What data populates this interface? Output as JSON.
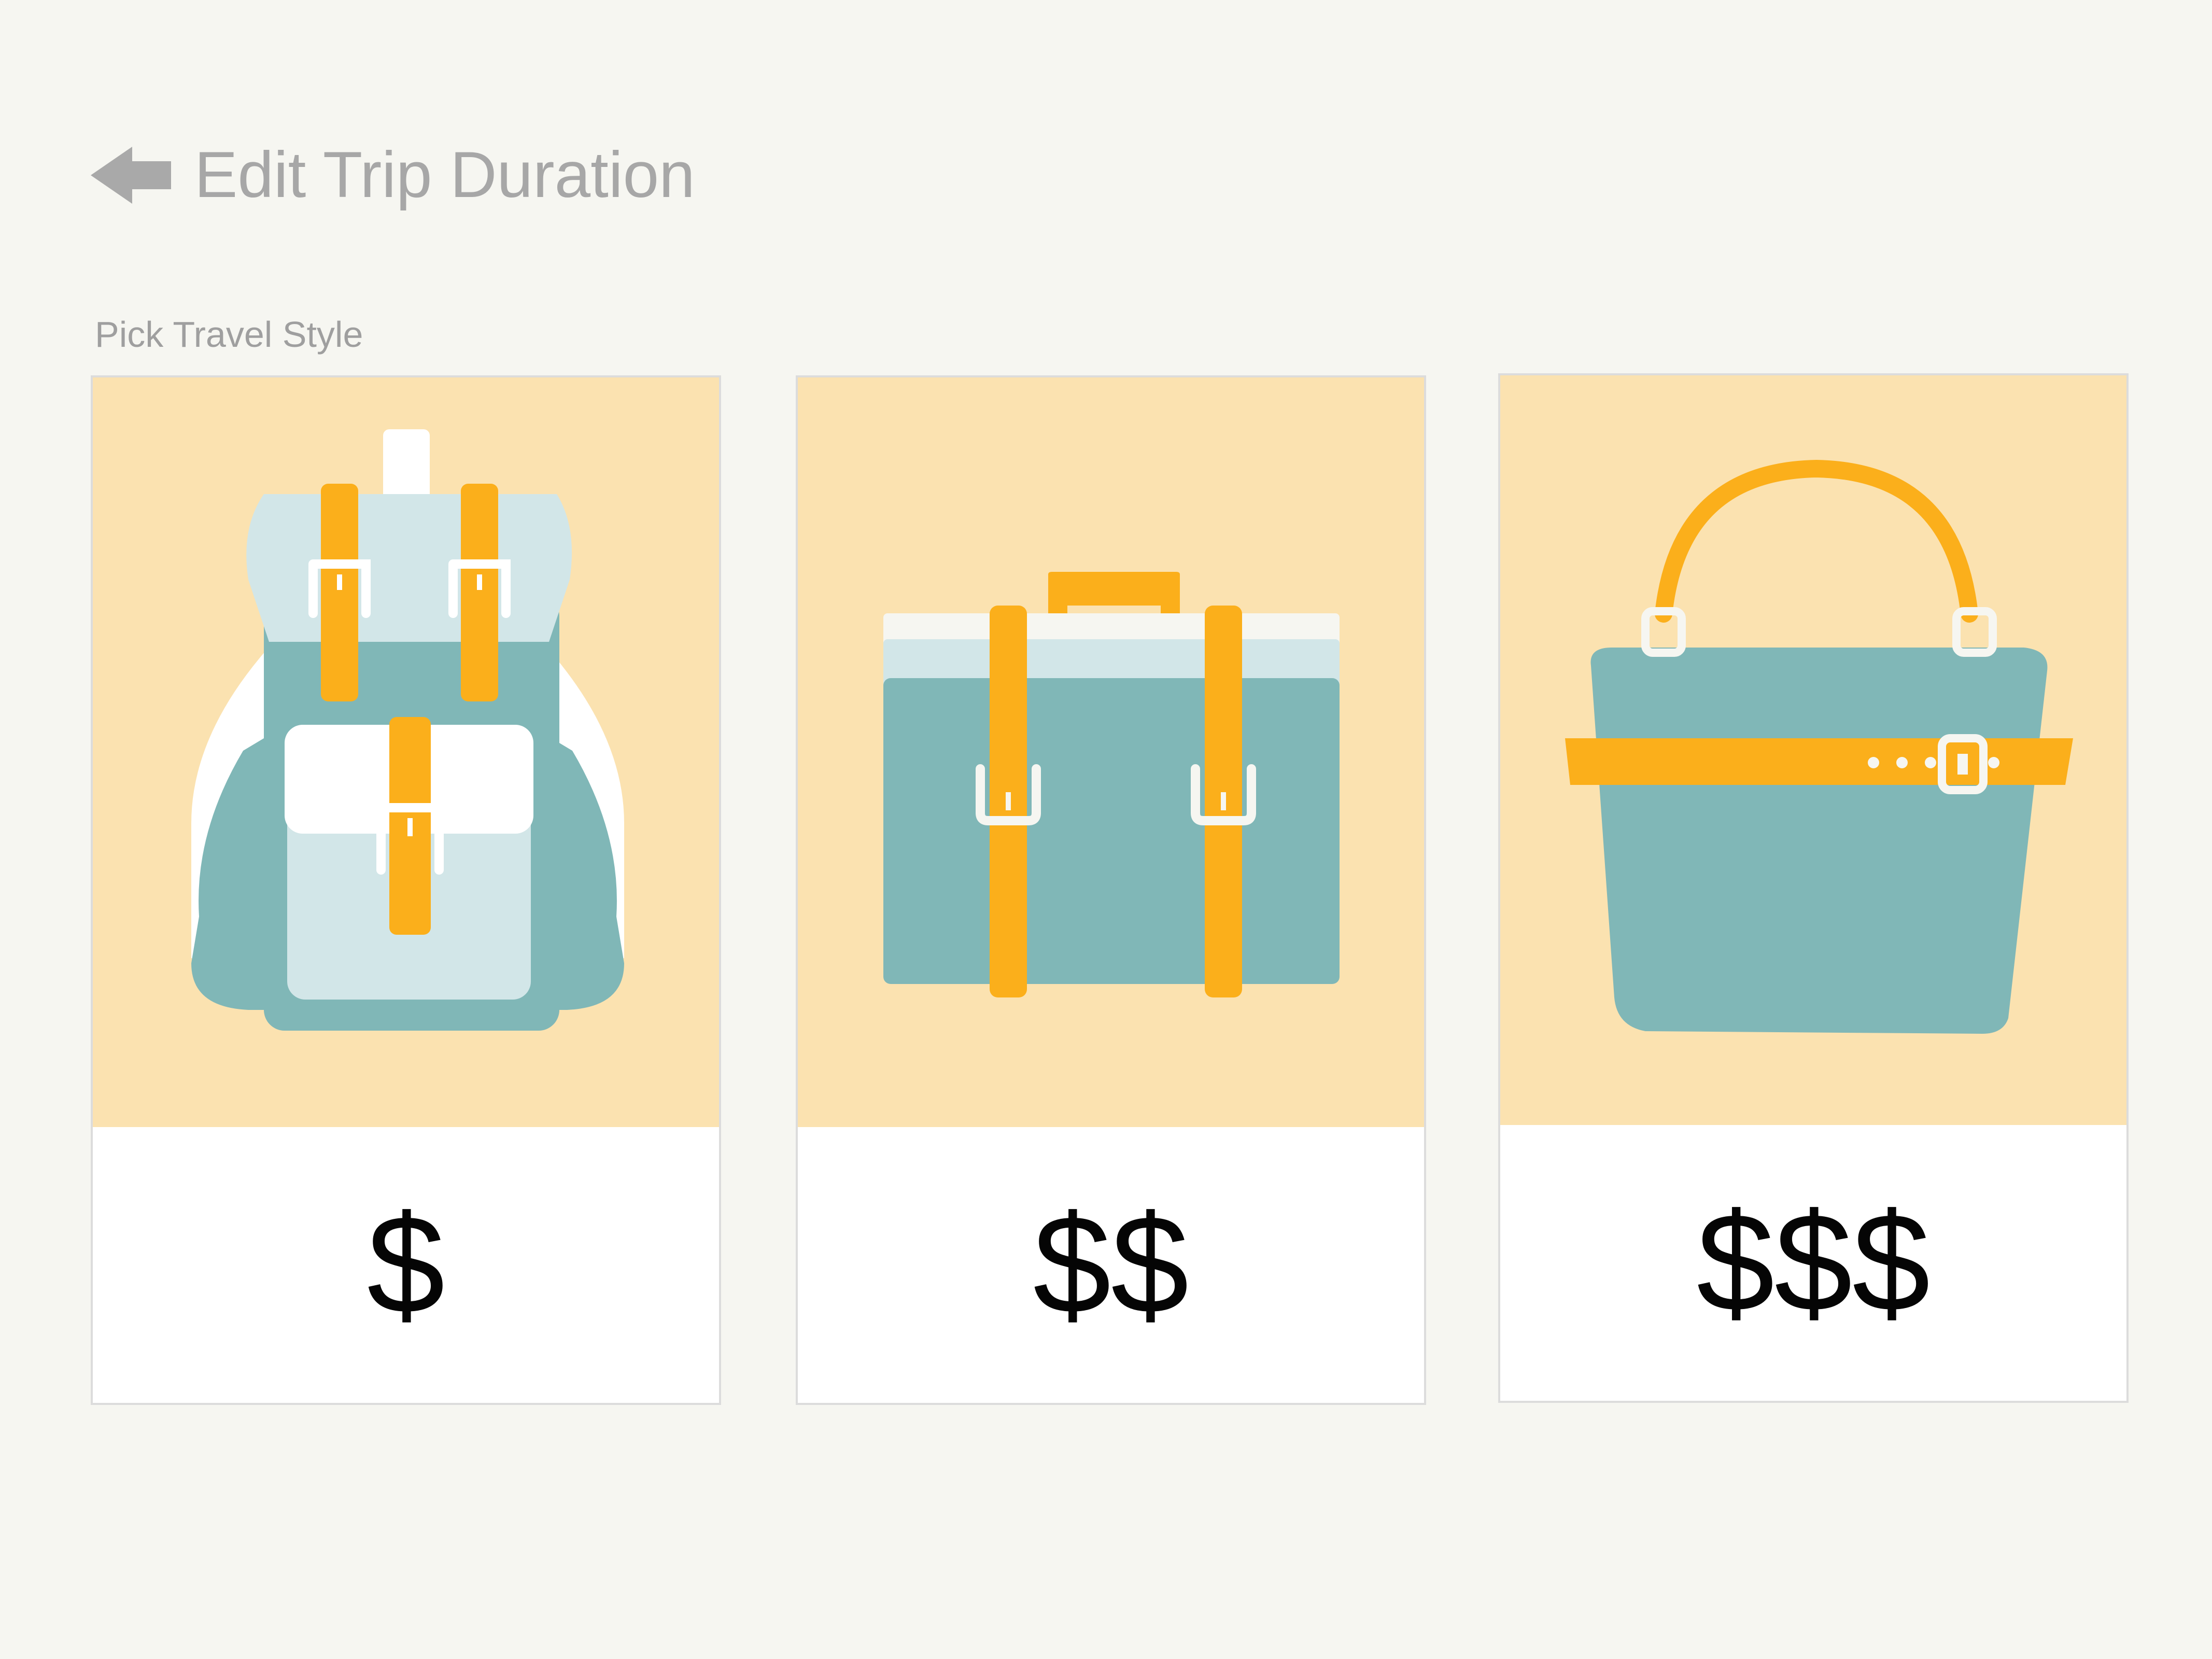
{
  "header": {
    "back_label": "Edit Trip Duration",
    "back_icon": "left-arrow-icon"
  },
  "section": {
    "label": "Pick Travel Style"
  },
  "cards": [
    {
      "icon": "backpack-icon",
      "price": "$"
    },
    {
      "icon": "suitcase-icon",
      "price": "$$"
    },
    {
      "icon": "handbag-icon",
      "price": "$$$"
    }
  ],
  "colors": {
    "background": "#f6f6f1",
    "card_art_bg": "#fbe2b0",
    "teal": "#80b7b7",
    "light_teal": "#d2e6e8",
    "orange": "#fbaf1b",
    "muted_text": "#a7a7a7"
  }
}
